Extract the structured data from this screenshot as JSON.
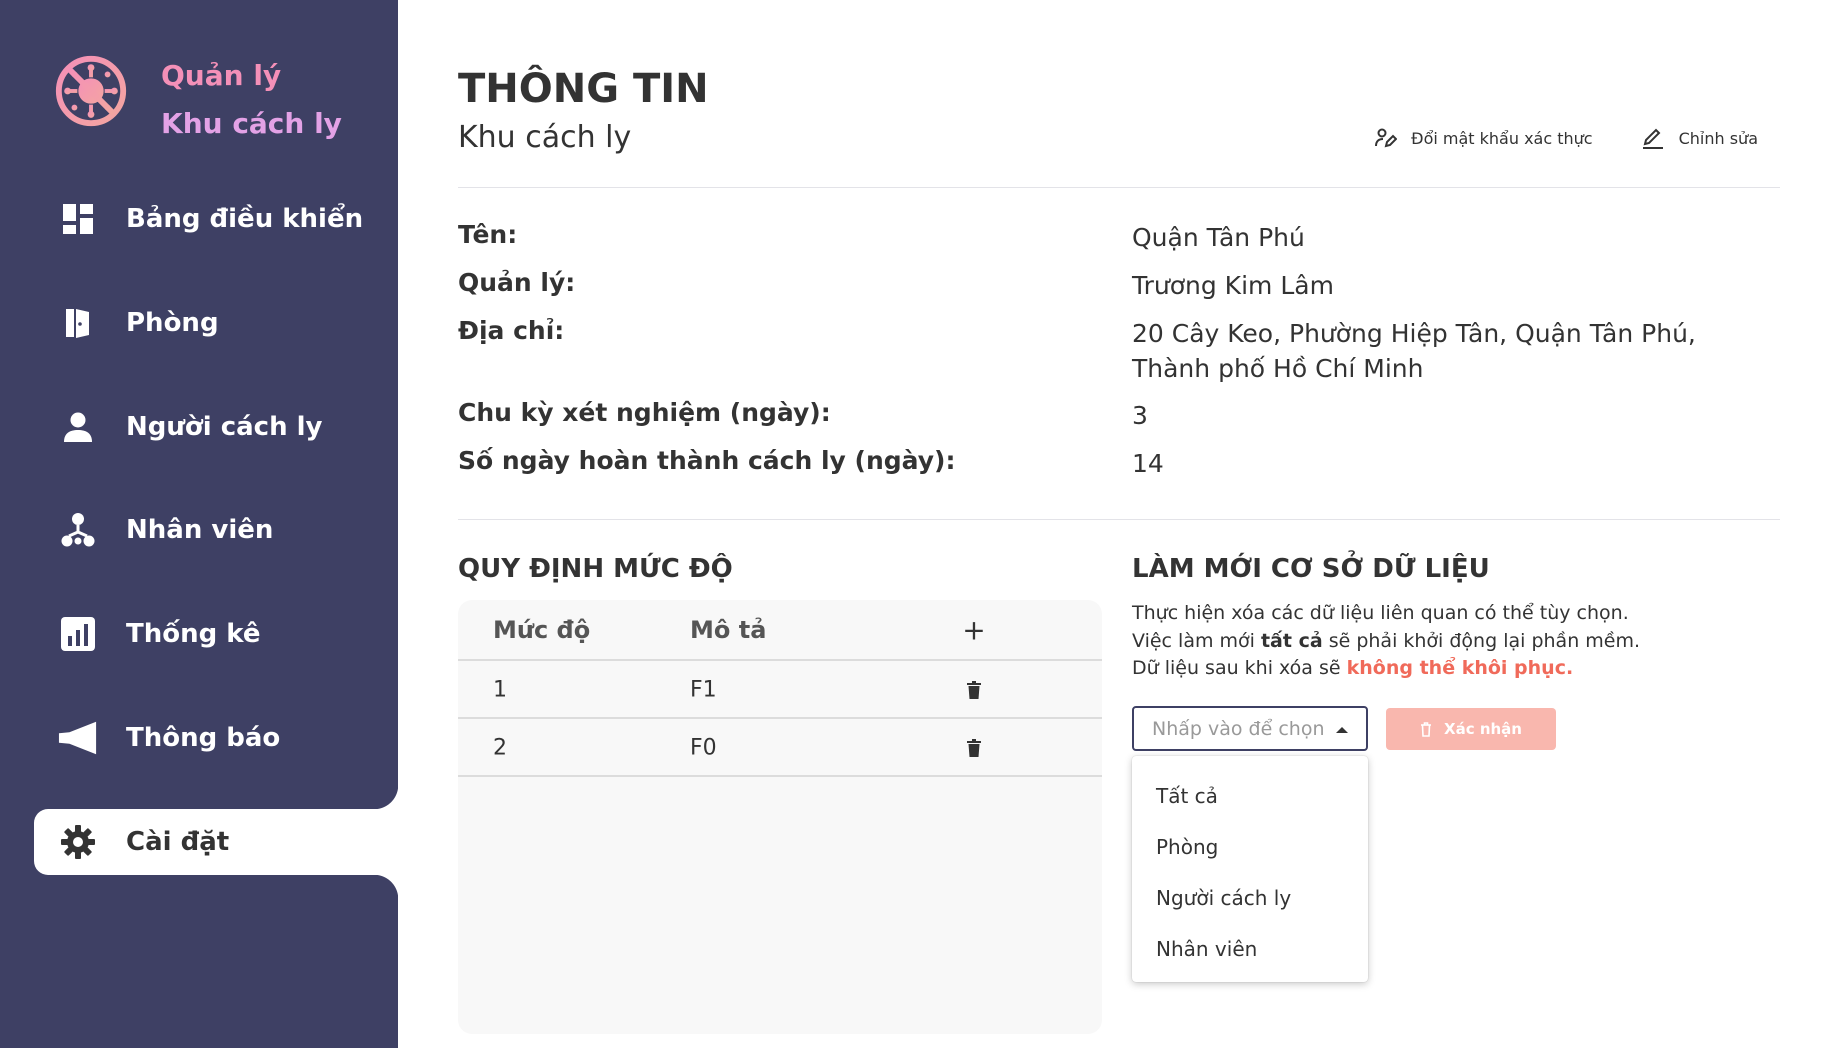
{
  "app": {
    "title_line1": "Quản lý",
    "title_line2": "Khu cách ly",
    "logo_icon": "virus-prohibited-icon"
  },
  "sidebar": {
    "items": [
      {
        "label": "Bảng điều khiển",
        "icon": "dashboard-icon"
      },
      {
        "label": "Phòng",
        "icon": "door-icon"
      },
      {
        "label": "Người cách ly",
        "icon": "person-icon"
      },
      {
        "label": "Nhân viên",
        "icon": "org-chart-icon"
      },
      {
        "label": "Thống kê",
        "icon": "bar-chart-icon"
      },
      {
        "label": "Thông báo",
        "icon": "megaphone-icon"
      },
      {
        "label": "Cài đặt",
        "icon": "gear-icon",
        "active": true
      }
    ]
  },
  "header": {
    "title": "THÔNG TIN",
    "subtitle": "Khu cách ly",
    "change_password_label": "Đổi mật khẩu xác thực",
    "edit_label": "Chỉnh sửa"
  },
  "info": {
    "name_label": "Tên:",
    "name_value": "Quận Tân Phú",
    "manager_label": "Quản lý:",
    "manager_value": "Trương Kim Lâm",
    "address_label": "Địa chỉ:",
    "address_value": "20 Cây Keo, Phường Hiệp Tân, Quận Tân Phú, Thành phố Hồ Chí Minh",
    "test_cycle_label": "Chu kỳ xét nghiệm (ngày):",
    "test_cycle_value": "3",
    "days_label": "Số ngày hoàn thành cách ly (ngày):",
    "days_value": "14"
  },
  "levels": {
    "title": "QUY ĐỊNH MỨC ĐỘ",
    "col_level": "Mức độ",
    "col_desc": "Mô tả",
    "add_symbol": "+",
    "rows": [
      {
        "level": "1",
        "desc": "F1"
      },
      {
        "level": "2",
        "desc": "F0"
      }
    ]
  },
  "refresh": {
    "title": "LÀM MỚI CƠ SỞ DỮ LIỆU",
    "line1": "Thực hiện xóa các dữ liệu liên quan có thể tùy chọn.",
    "line2_pre": "Việc làm mới ",
    "line2_bold": "tất cả",
    "line2_post": " sẽ phải khởi động lại phần mềm.",
    "line3_pre": "Dữ liệu sau khi xóa sẽ ",
    "line3_warn": "không thể khôi phục.",
    "select_placeholder": "Nhấp vào để chọn",
    "confirm_label": "Xác nhận",
    "options": [
      "Tất cả",
      "Phòng",
      "Người cách ly",
      "Nhân viên"
    ]
  },
  "colors": {
    "sidebar_bg": "#3e4064",
    "warn": "#f06a5a",
    "confirm_disabled": "#f9b7ae",
    "logo_pink": "#f490b8"
  }
}
